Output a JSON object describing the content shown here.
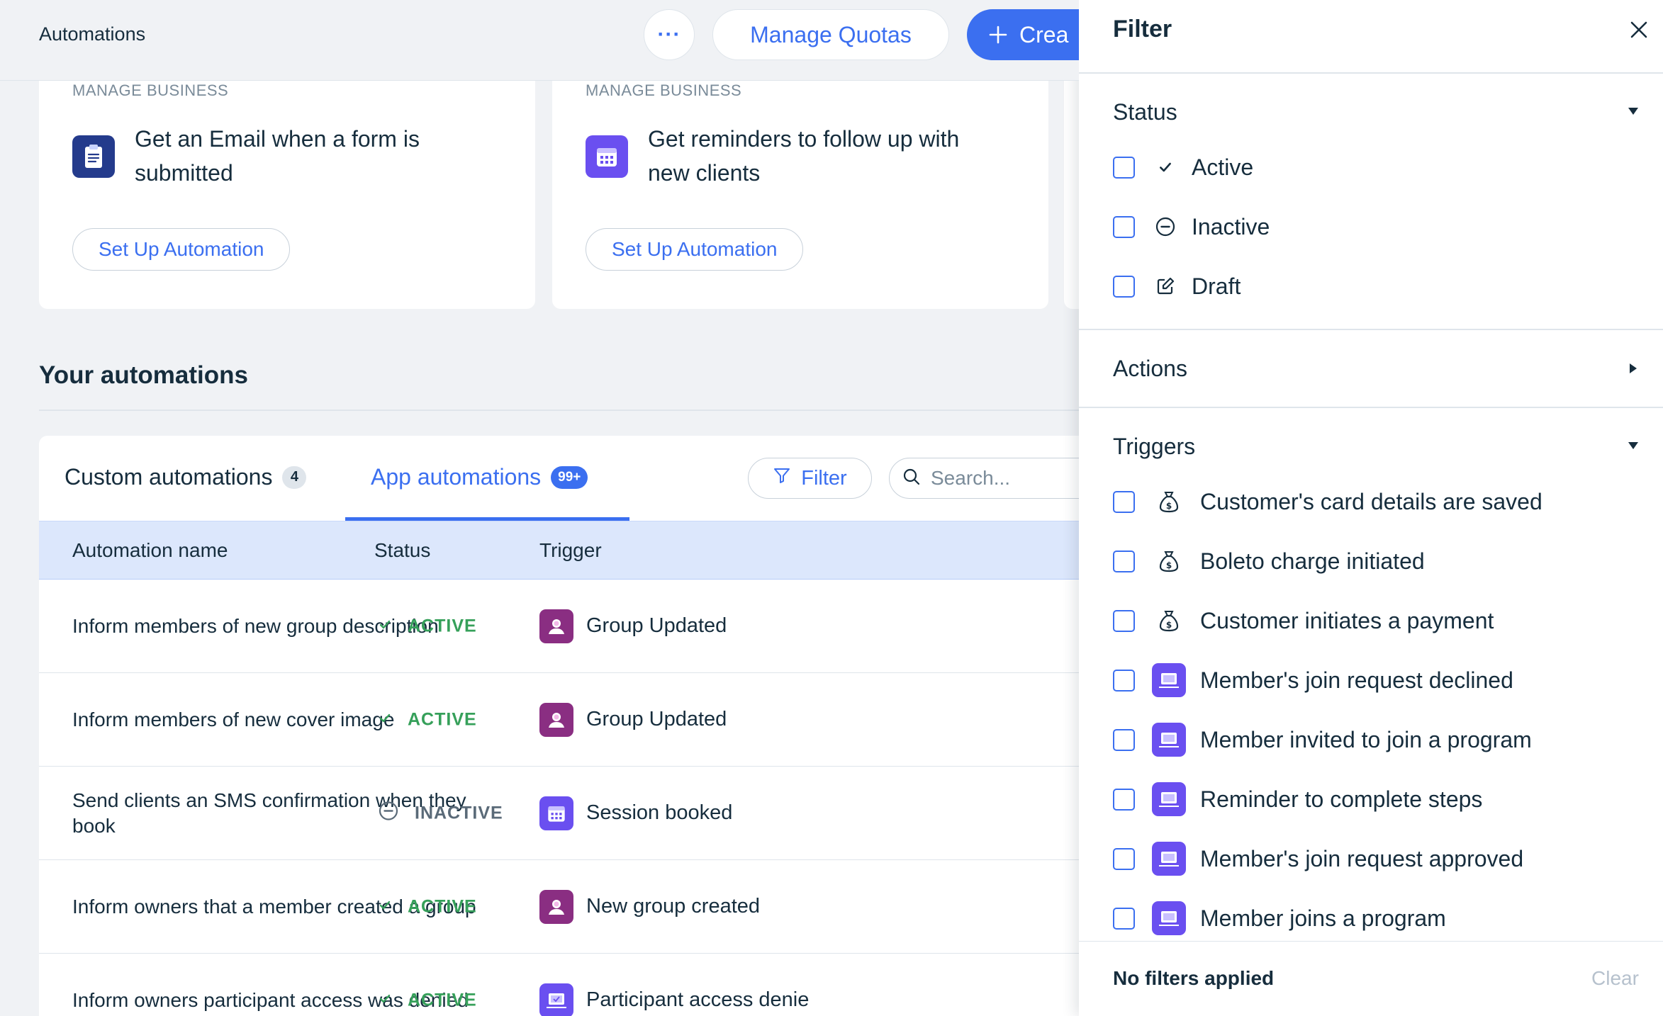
{
  "header": {
    "title": "Automations",
    "more_label": "···",
    "manage_quotas": "Manage Quotas",
    "create_label": "Crea"
  },
  "cards": [
    {
      "category": "MANAGE BUSINESS",
      "text": "Get an Email when a form is submitted",
      "button": "Set Up Automation",
      "icon": "clipboard-icon"
    },
    {
      "category": "MANAGE BUSINESS",
      "text": "Get reminders to follow up with new clients",
      "button": "Set Up Automation",
      "icon": "calendar-icon"
    }
  ],
  "section": {
    "title": "Your automations"
  },
  "tabs": [
    {
      "label": "Custom automations",
      "badge": "4"
    },
    {
      "label": "App automations",
      "badge": "99+"
    }
  ],
  "toolbar": {
    "filter_label": "Filter",
    "search_placeholder": "Search..."
  },
  "table": {
    "columns": [
      "Automation name",
      "Status",
      "Trigger"
    ],
    "rows": [
      {
        "name": "Inform members of new group description",
        "status": "ACTIVE",
        "trigger": "Group Updated",
        "trigger_icon": "group-icon"
      },
      {
        "name": "Inform members of new cover image",
        "status": "ACTIVE",
        "trigger": "Group Updated",
        "trigger_icon": "group-icon"
      },
      {
        "name": "Send clients an SMS confirmation when they book",
        "status": "INACTIVE",
        "trigger": "Session booked",
        "trigger_icon": "calendar-icon"
      },
      {
        "name": "Inform owners that a member created a group",
        "status": "ACTIVE",
        "trigger": "New group created",
        "trigger_icon": "group-icon"
      },
      {
        "name": "Inform owners participant access was denied",
        "status": "ACTIVE",
        "trigger": "Participant access denie",
        "trigger_icon": "laptop-icon"
      }
    ]
  },
  "filter": {
    "title": "Filter",
    "status_section": {
      "title": "Status",
      "options": [
        {
          "label": "Active",
          "icon": "check-icon"
        },
        {
          "label": "Inactive",
          "icon": "minus-circle-icon"
        },
        {
          "label": "Draft",
          "icon": "edit-icon"
        }
      ]
    },
    "actions_section": {
      "title": "Actions"
    },
    "triggers_section": {
      "title": "Triggers",
      "options": [
        {
          "label": "Customer's card details are saved",
          "icon": "money-bag-icon"
        },
        {
          "label": "Boleto charge initiated",
          "icon": "money-bag-icon"
        },
        {
          "label": "Customer initiates a payment",
          "icon": "money-bag-icon"
        },
        {
          "label": "Member's join request declined",
          "icon": "laptop-icon"
        },
        {
          "label": "Member invited to join a program",
          "icon": "laptop-icon"
        },
        {
          "label": "Reminder to complete steps",
          "icon": "laptop-icon"
        },
        {
          "label": "Member's join request approved",
          "icon": "laptop-icon"
        },
        {
          "label": "Member joins a program",
          "icon": "laptop-icon"
        }
      ]
    },
    "footer": {
      "status": "No filters applied",
      "clear": "Clear"
    }
  },
  "colors": {
    "accent": "#3b6ff0",
    "active": "#36a05a",
    "inactive": "#5a6a78",
    "table_header": "#dce7fc"
  }
}
